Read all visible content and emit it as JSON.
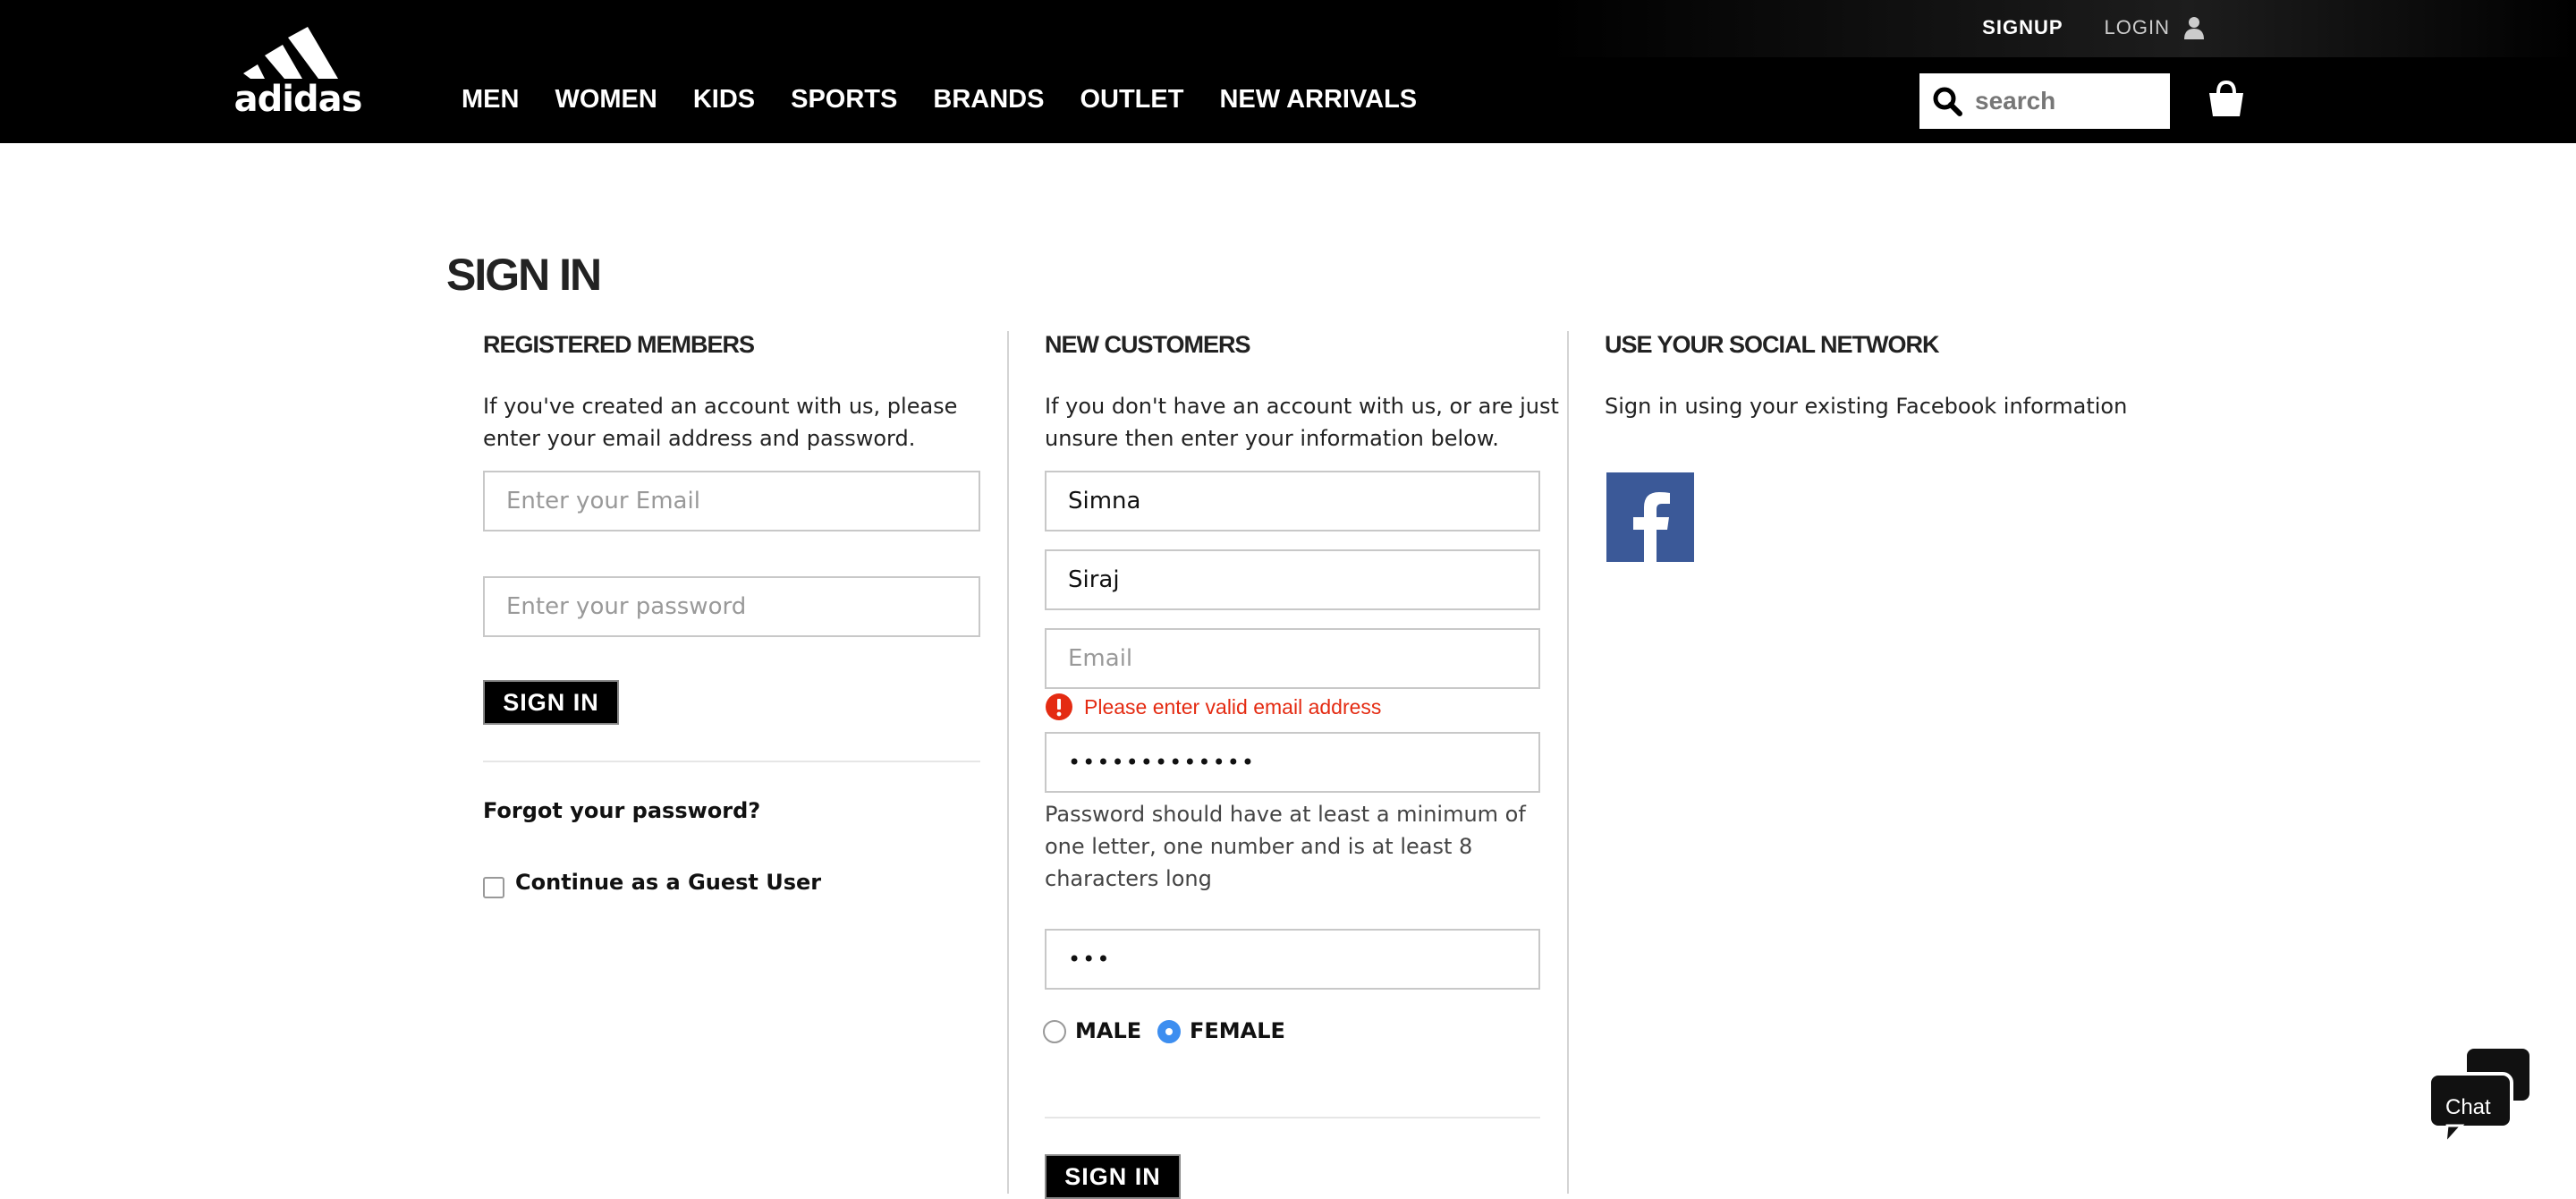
{
  "header": {
    "logo_text": "adidas",
    "top_links": {
      "signup": "SIGNUP",
      "login": "LOGIN"
    },
    "nav": [
      "MEN",
      "WOMEN",
      "KIDS",
      "SPORTS",
      "BRANDS",
      "OUTLET",
      "NEW ARRIVALS"
    ],
    "search_placeholder": "search",
    "icons": [
      "adidas-logo",
      "user-icon",
      "search-icon",
      "shopping-bag-icon"
    ]
  },
  "page": {
    "title": "SIGN IN"
  },
  "registered": {
    "title": "REGISTERED MEMBERS",
    "desc_line1": "If you've created an account with us, please",
    "desc_line2": "enter your email address and password.",
    "email_placeholder": "Enter your Email",
    "password_placeholder": "Enter your password",
    "signin_label": "SIGN IN",
    "forgot_label": "Forgot your password?",
    "guest_label": "Continue as a Guest User",
    "guest_checked": false
  },
  "new_customers": {
    "title": "NEW CUSTOMERS",
    "desc_line1": "If you don't have an account with us, or are just",
    "desc_line2": "unsure then enter your information below.",
    "first_name_value": "Simna",
    "last_name_value": "Siraj",
    "email_placeholder": "Email",
    "email_error": "Please enter valid email address",
    "password_value": "•••••••••••••",
    "password_hint_line1": "Password should have at least a minimum of",
    "password_hint_line2": "one letter, one number and is at least 8",
    "password_hint_line3": "characters long",
    "confirm_value": "•••",
    "gender_options": [
      "MALE",
      "FEMALE"
    ],
    "gender_selected": "FEMALE",
    "signin_label": "SIGN IN"
  },
  "social": {
    "title": "USE YOUR SOCIAL NETWORK",
    "desc": "Sign in using your existing Facebook information",
    "icon": "facebook-icon"
  },
  "chat": {
    "label": "Chat",
    "icon": "chat-bubble-icon"
  },
  "colors": {
    "header_bg": "#000000",
    "error": "#e42b12",
    "radio_selected": "#3d8ef0",
    "facebook": "#3b5998"
  }
}
